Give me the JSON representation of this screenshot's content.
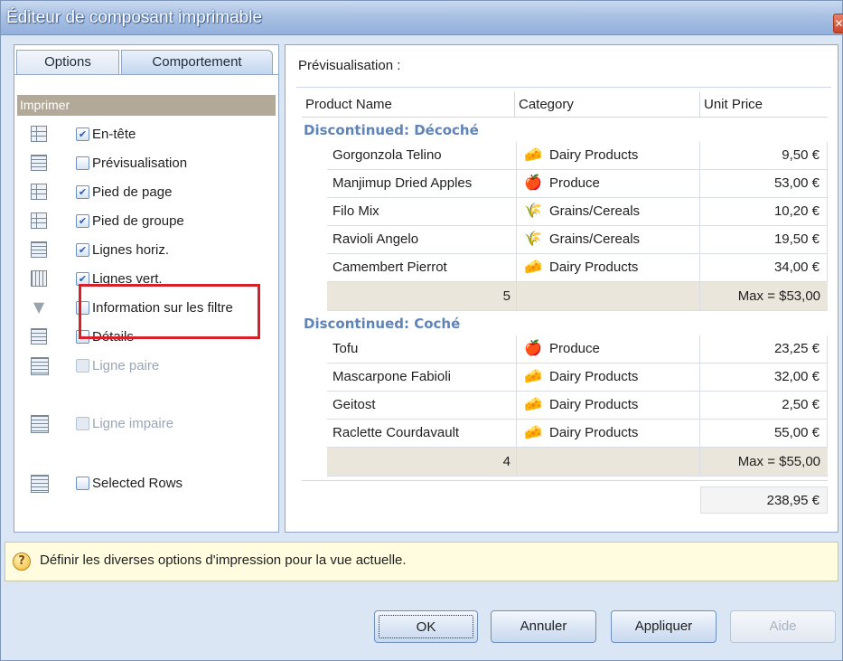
{
  "window": {
    "title": "Éditeur de composant imprimable",
    "close_glyph": "✕"
  },
  "tabs": [
    {
      "label": "Options"
    },
    {
      "label": "Comportement"
    }
  ],
  "section": {
    "title": "Imprimer"
  },
  "options": [
    {
      "label": "En-tête",
      "checked": true,
      "enabled": true,
      "icon": "grid-header-icon"
    },
    {
      "label": "Prévisualisation",
      "checked": false,
      "enabled": true,
      "icon": "grid-preview-icon"
    },
    {
      "label": "Pied de page",
      "checked": true,
      "enabled": true,
      "icon": "grid-footer-icon"
    },
    {
      "label": "Pied de groupe",
      "checked": true,
      "enabled": true,
      "icon": "grid-group-footer-icon"
    },
    {
      "label": "Lignes horiz.",
      "checked": true,
      "enabled": true,
      "icon": "horizontal-lines-icon"
    },
    {
      "label": "Lignes vert.",
      "checked": true,
      "enabled": true,
      "icon": "vertical-lines-icon"
    },
    {
      "label": "Information sur les filtre",
      "checked": false,
      "enabled": true,
      "icon": "filter-icon"
    },
    {
      "label": "Détails",
      "checked": false,
      "enabled": true,
      "icon": "details-icon"
    },
    {
      "label": "Ligne paire",
      "checked": false,
      "enabled": false,
      "icon": "even-row-icon"
    },
    {
      "label": "Ligne impaire",
      "checked": false,
      "enabled": false,
      "icon": "odd-row-icon"
    },
    {
      "label": "Selected Rows",
      "checked": false,
      "enabled": true,
      "icon": "selected-rows-icon"
    }
  ],
  "check_glyph": "✔",
  "preview": {
    "label": "Prévisualisation :",
    "columns": [
      "Product Name",
      "Category",
      "Unit Price"
    ],
    "groups": [
      {
        "title": "Discontinued: Décoché",
        "rows": [
          {
            "name": "Gorgonzola Telino",
            "category": "Dairy Products",
            "cat_icon": "dairy-icon",
            "price": "9,50 €"
          },
          {
            "name": "Manjimup Dried Apples",
            "category": "Produce",
            "cat_icon": "produce-icon",
            "price": "53,00 €"
          },
          {
            "name": "Filo Mix",
            "category": "Grains/Cereals",
            "cat_icon": "grains-icon",
            "price": "10,20 €"
          },
          {
            "name": "Ravioli Angelo",
            "category": "Grains/Cereals",
            "cat_icon": "grains-icon",
            "price": "19,50 €"
          },
          {
            "name": "Camembert Pierrot",
            "category": "Dairy Products",
            "cat_icon": "dairy-icon",
            "price": "34,00 €"
          }
        ],
        "count": "5",
        "max": "Max = $53,00"
      },
      {
        "title": "Discontinued: Coché",
        "rows": [
          {
            "name": "Tofu",
            "category": "Produce",
            "cat_icon": "produce-icon",
            "price": "23,25 €"
          },
          {
            "name": "Mascarpone Fabioli",
            "category": "Dairy Products",
            "cat_icon": "dairy-icon",
            "price": "32,00 €"
          },
          {
            "name": "Geitost",
            "category": "Dairy Products",
            "cat_icon": "dairy-icon",
            "price": "2,50 €"
          },
          {
            "name": "Raclette Courdavault",
            "category": "Dairy Products",
            "cat_icon": "dairy-icon",
            "price": "55,00 €"
          }
        ],
        "count": "4",
        "max": "Max = $55,00"
      }
    ],
    "total": "238,95 €"
  },
  "status": {
    "icon": "hint-icon",
    "icon_glyph": "?",
    "text": "Définir les diverses options d'impression pour la vue actuelle."
  },
  "buttons": {
    "ok": "OK",
    "cancel": "Annuler",
    "apply": "Appliquer",
    "help": "Aide"
  }
}
